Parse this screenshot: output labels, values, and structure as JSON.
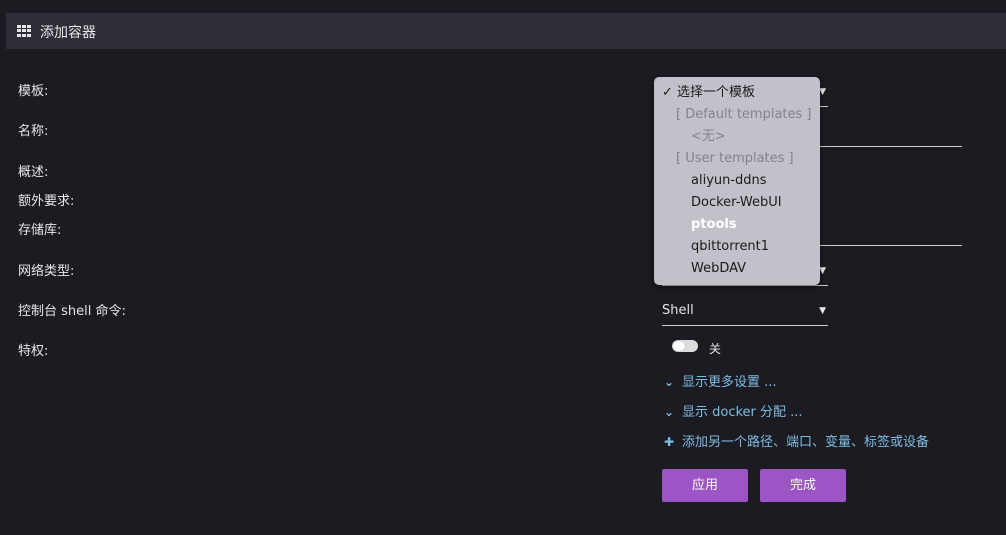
{
  "header": {
    "title": "添加容器",
    "icon": "grid-icon"
  },
  "form": {
    "template_label": "模板:",
    "name_label": "名称:",
    "overview_label": "概述:",
    "extra_label": "额外要求:",
    "repo_label": "存储库:",
    "network_label": "网络类型:",
    "console_label": "控制台 shell 命令:",
    "privileged_label": "特权:",
    "console_value": "Shell",
    "privileged_toggle_text": "关",
    "privileged_on": false
  },
  "links": {
    "more_settings": "显示更多设置 ...",
    "docker_alloc": "显示 docker 分配 ...",
    "add_path": "添加另一个路径、端口、变量、标签或设备"
  },
  "buttons": {
    "apply": "应用",
    "done": "完成"
  },
  "dropdown": {
    "selected": "✓ 选择一个模板",
    "group_default": "[ Default templates ]",
    "none_option": "<无>",
    "group_user": "[ User templates ]",
    "items": [
      "aliyun-ddns",
      "Docker-WebUI",
      "ptools",
      "qbittorrent1",
      "WebDAV"
    ],
    "highlighted": "ptools"
  },
  "colors": {
    "background": "#1c1b22",
    "header": "#2f2e38",
    "accent_button": "#9b55c5",
    "link": "#7fbde3",
    "dropdown_bg": "#c3c0c9"
  }
}
